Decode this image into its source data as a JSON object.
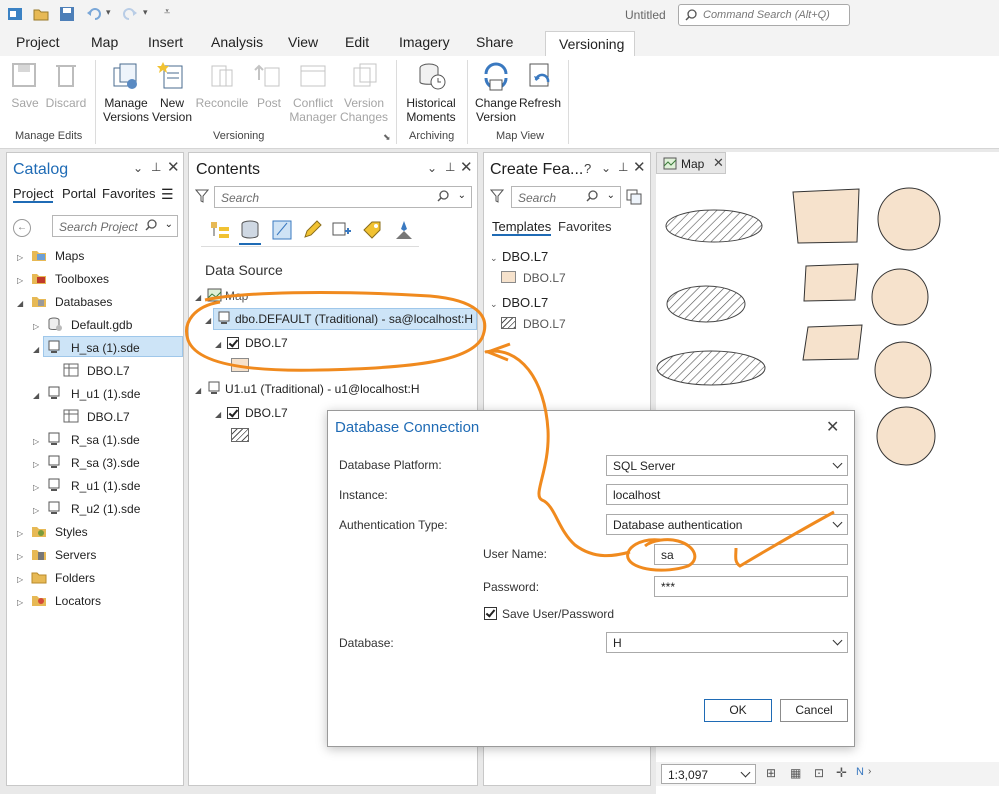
{
  "title_bar": {
    "doc_title": "Untitled",
    "command_search_placeholder": "Command Search (Alt+Q)"
  },
  "ribbon_tabs": [
    "Project",
    "Map",
    "Insert",
    "Analysis",
    "View",
    "Edit",
    "Imagery",
    "Share",
    "Versioning"
  ],
  "ribbon": {
    "buttons": {
      "save": "Save",
      "discard": "Discard",
      "manage_versions": [
        "Manage",
        "Versions"
      ],
      "new_version": [
        "New",
        "Version"
      ],
      "reconcile": "Reconcile",
      "post": "Post",
      "conflict_manager": [
        "Conflict",
        "Manager"
      ],
      "version_changes": [
        "Version",
        "Changes"
      ],
      "historical_moments": [
        "Historical",
        "Moments"
      ],
      "change_version": [
        "Change",
        "Version"
      ],
      "refresh": "Refresh"
    },
    "groups": {
      "manage_edits": "Manage Edits",
      "versioning": "Versioning",
      "archiving": "Archiving",
      "map_view": "Map View"
    }
  },
  "catalog": {
    "title": "Catalog",
    "tabs": [
      "Project",
      "Portal",
      "Favorites"
    ],
    "search_placeholder": "Search Project",
    "items": [
      "Maps",
      "Toolboxes",
      "Databases",
      "Default.gdb",
      "H_sa (1).sde",
      "DBO.L7",
      "H_u1 (1).sde",
      "DBO.L7",
      "R_sa (1).sde",
      "R_sa (3).sde",
      "R_u1 (1).sde",
      "R_u2 (1).sde",
      "Styles",
      "Servers",
      "Folders",
      "Locators"
    ]
  },
  "contents": {
    "title": "Contents",
    "search_placeholder": "Search",
    "section": "Data Source",
    "map": "Map",
    "connection1": "dbo.DEFAULT (Traditional) - sa@localhost:H",
    "layer1": "DBO.L7",
    "connection2": "U1.u1 (Traditional) - u1@localhost:H",
    "layer2": "DBO.L7"
  },
  "create_features": {
    "title": "Create Fea...",
    "help": "?",
    "search_placeholder": "Search",
    "tabs": [
      "Templates",
      "Favorites"
    ],
    "groups": [
      {
        "name": "DBO.L7",
        "item": "DBO.L7"
      },
      {
        "name": "DBO.L7",
        "item": "DBO.L7"
      }
    ]
  },
  "map": {
    "tab": "Map",
    "scale": "1:3,097",
    "fill_color": "#f6e2cc"
  },
  "dialog": {
    "title": "Database Connection",
    "platform_label": "Database Platform:",
    "platform_value": "SQL Server",
    "instance_label": "Instance:",
    "instance_value": "localhost",
    "auth_label": "Authentication Type:",
    "auth_value": "Database authentication",
    "username_label": "User Name:",
    "username_value": "sa",
    "password_label": "Password:",
    "password_value": "***",
    "save_label": "Save User/Password",
    "database_label": "Database:",
    "database_value": "H",
    "ok": "OK",
    "cancel": "Cancel"
  },
  "colors": {
    "accent": "#1f6bb5",
    "annotation": "#f08a1e",
    "selection": "#cde4f7"
  }
}
